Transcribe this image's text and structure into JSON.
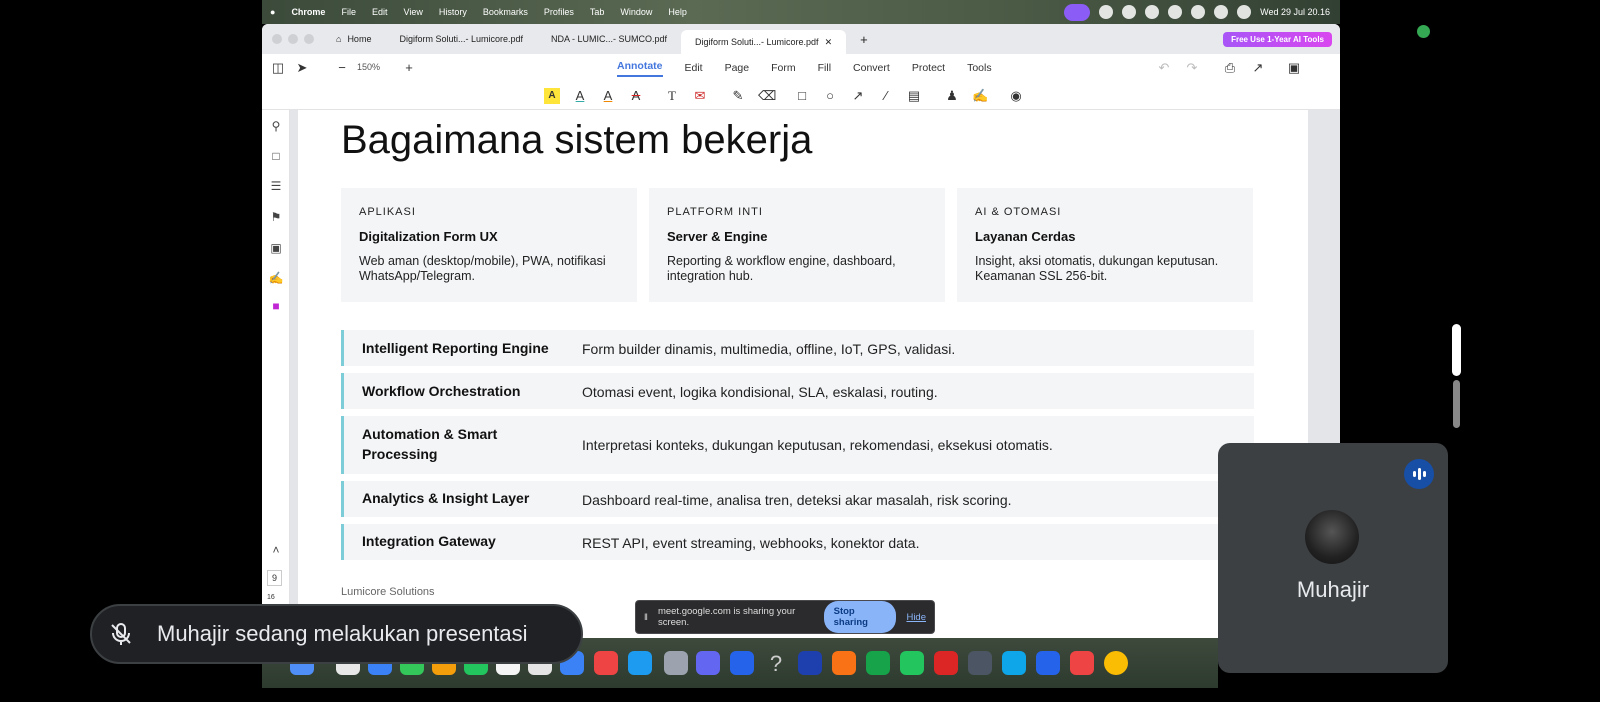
{
  "menubar": {
    "app": "Chrome",
    "items": [
      "File",
      "Edit",
      "View",
      "History",
      "Bookmarks",
      "Profiles",
      "Tab",
      "Window",
      "Help"
    ],
    "clock": "Wed 29 Jul  20.16"
  },
  "tabs": [
    {
      "label": "Home"
    },
    {
      "label": "Digiform Soluti...- Lumicore.pdf"
    },
    {
      "label": "NDA - LUMIC...- SUMCO.pdf"
    },
    {
      "label": "Digiform Soluti...- Lumicore.pdf"
    }
  ],
  "promo": "Free Use 1-Year AI Tools",
  "zoom": "150%",
  "menu": [
    "Annotate",
    "Edit",
    "Page",
    "Form",
    "Fill",
    "Convert",
    "Protect",
    "Tools"
  ],
  "doc": {
    "title": "Bagaimana sistem bekerja",
    "cards": [
      {
        "kicker": "APLIKASI",
        "title": "Digitalization Form UX",
        "desc": "Web aman (desktop/mobile), PWA, notifikasi WhatsApp/Telegram."
      },
      {
        "kicker": "PLATFORM INTI",
        "title": "Server & Engine",
        "desc": "Reporting & workflow engine, dashboard, integration hub."
      },
      {
        "kicker": "AI & OTOMASI",
        "title": "Layanan Cerdas",
        "desc": "Insight, aksi otomatis, dukungan keputusan. Keamanan SSL 256-bit."
      }
    ],
    "rows": [
      {
        "title": "Intelligent Reporting Engine",
        "desc": "Form builder dinamis, multimedia, offline, IoT, GPS, validasi."
      },
      {
        "title": "Workflow Orchestration",
        "desc": "Otomasi event, logika kondisional, SLA, eskalasi, routing."
      },
      {
        "title": "Automation & Smart Processing",
        "desc": "Interpretasi konteks, dukungan keputusan, rekomendasi, eksekusi otomatis."
      },
      {
        "title": "Analytics & Insight Layer",
        "desc": "Dashboard real-time, analisa tren, deteksi akar masalah, risk scoring."
      },
      {
        "title": "Integration Gateway",
        "desc": "REST API, event streaming, webhooks, konektor data."
      }
    ],
    "footer": "Lumicore Solutions"
  },
  "page_numbers": [
    "9",
    "16"
  ],
  "share_bar": {
    "message": "meet.google.com is sharing your screen.",
    "stop": "Stop sharing",
    "hide": "Hide"
  },
  "presenter_banner": "Muhajir sedang melakukan presentasi",
  "participant": {
    "name": "Muhajir"
  },
  "colors": {
    "accent": "#4477dd",
    "row_border": "#7ccdd8",
    "stop_button": "#8ab4f8",
    "meet_dark": "#202124"
  }
}
